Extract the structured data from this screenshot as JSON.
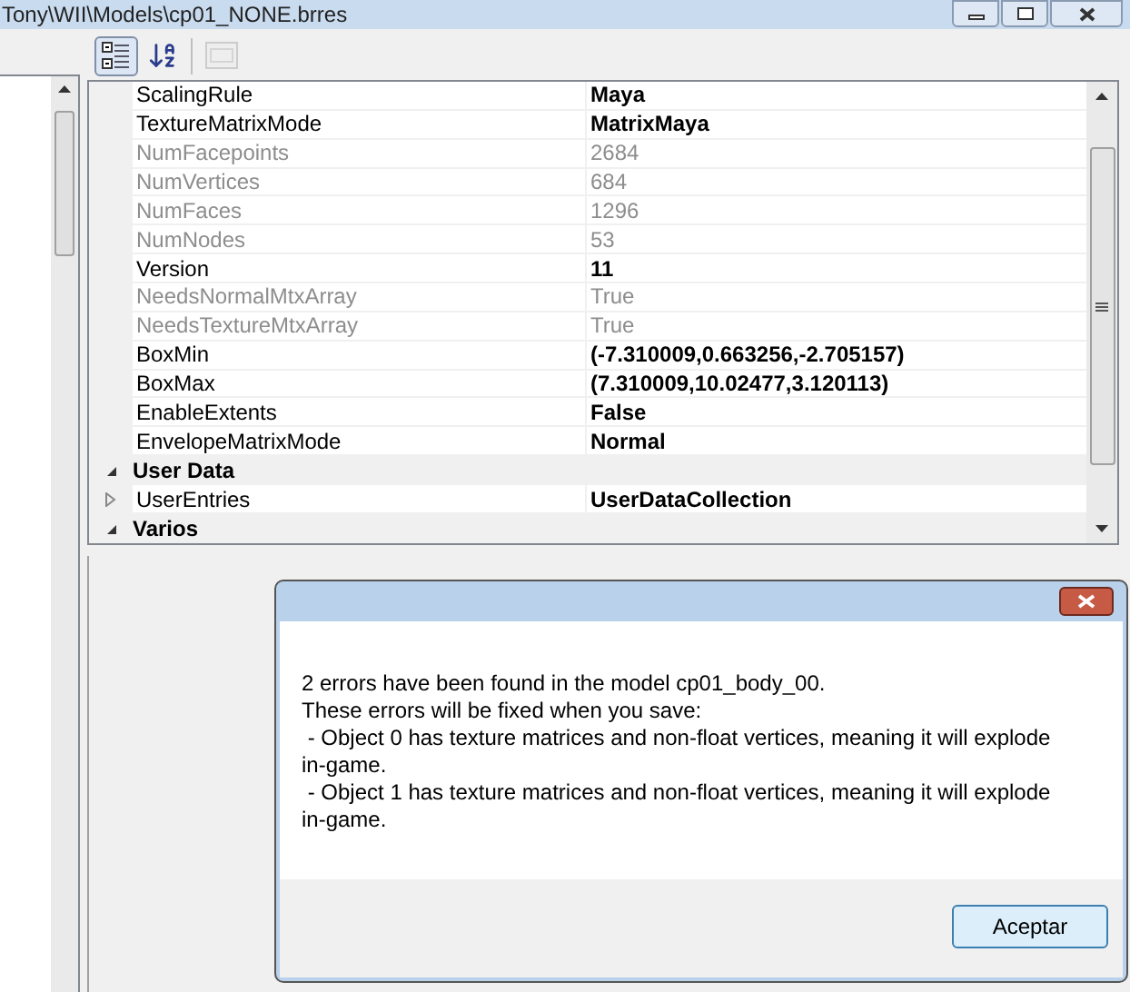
{
  "window": {
    "title": "Tony\\WII\\Models\\cp01_NONE.brres"
  },
  "toolbar": [
    {
      "kind": "categorized",
      "selected": true,
      "disabled": false
    },
    {
      "kind": "alphabetical",
      "selected": false,
      "disabled": false
    },
    {
      "kind": "pages",
      "selected": false,
      "disabled": true
    }
  ],
  "properties": [
    {
      "kind": "property",
      "name": "ScalingRule",
      "value": "Maya",
      "readonly": false
    },
    {
      "kind": "property",
      "name": "TextureMatrixMode",
      "value": "MatrixMaya",
      "readonly": false
    },
    {
      "kind": "property",
      "name": "NumFacepoints",
      "value": "2684",
      "readonly": true
    },
    {
      "kind": "property",
      "name": "NumVertices",
      "value": "684",
      "readonly": true
    },
    {
      "kind": "property",
      "name": "NumFaces",
      "value": "1296",
      "readonly": true
    },
    {
      "kind": "property",
      "name": "NumNodes",
      "value": "53",
      "readonly": true
    },
    {
      "kind": "property",
      "name": "Version",
      "value": "11",
      "readonly": false
    },
    {
      "kind": "property",
      "name": "NeedsNormalMtxArray",
      "value": "True",
      "readonly": true
    },
    {
      "kind": "property",
      "name": "NeedsTextureMtxArray",
      "value": "True",
      "readonly": true
    },
    {
      "kind": "property",
      "name": "BoxMin",
      "value": "(-7.310009,0.663256,-2.705157)",
      "readonly": false
    },
    {
      "kind": "property",
      "name": "BoxMax",
      "value": "(7.310009,10.02477,3.120113)",
      "readonly": false
    },
    {
      "kind": "property",
      "name": "EnableExtents",
      "value": "False",
      "readonly": false
    },
    {
      "kind": "property",
      "name": "EnvelopeMatrixMode",
      "value": "Normal",
      "readonly": false
    },
    {
      "kind": "category",
      "name": "User Data",
      "expanded": true
    },
    {
      "kind": "expandable",
      "name": "UserEntries",
      "value": "UserDataCollection",
      "readonly": false,
      "expanded": false
    },
    {
      "kind": "category",
      "name": "Varios",
      "expanded": true
    }
  ],
  "dialog": {
    "lines": [
      "2 errors have been found in the model cp01_body_00.",
      "These errors will be fixed when you save:",
      " - Object 0 has texture matrices and non-float vertices, meaning it will explode in-game.",
      " - Object 1 has texture matrices and non-float vertices, meaning it will explode in-game."
    ],
    "button": "Aceptar"
  }
}
